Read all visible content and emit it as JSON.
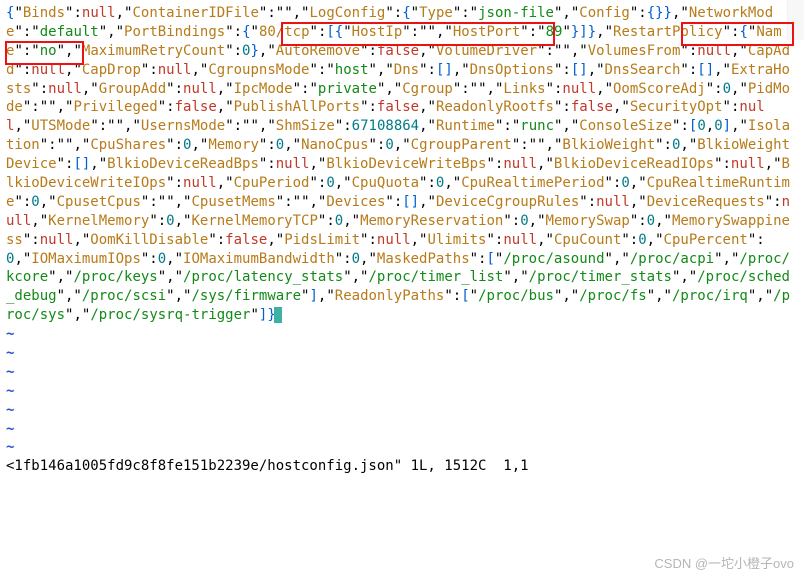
{
  "status_line": "<1fb146a1005fd9c8f8fe151b2239e/hostconfig.json\" 1L, 1512C  1,1",
  "watermark": "CSDN @一坨小橙子ovo",
  "t": {
    "Binds": "Binds",
    "ContainerIDFile": "ContainerIDFile",
    "LogConfig": "LogConfig",
    "Type": "Type",
    "json_file": "json-file",
    "Config": "Config",
    "NetworkMode": "NetworkMode",
    "default": "default",
    "PortBindings": "PortBindings",
    "port80": "80/tcp",
    "HostIp": "HostIp",
    "HostPort": "HostPort",
    "port89": "89",
    "RestartPolicy": "RestartPolicy",
    "Name": "Name",
    "no": "no",
    "MaximumRetryCount": "MaximumRetryCount",
    "AutoRemove": "AutoRemove",
    "VolumeDriver": "VolumeDriver",
    "VolumesFrom": "VolumesFrom",
    "CapAdd": "CapAdd",
    "CapDrop": "CapDrop",
    "CgroupnsMode": "CgroupnsMode",
    "host": "host",
    "Dns": "Dns",
    "DnsOptions": "DnsOptions",
    "DnsSearch": "DnsSearch",
    "ExtraHosts": "ExtraHosts",
    "GroupAdd": "GroupAdd",
    "IpcMode": "IpcMode",
    "private": "private",
    "Cgroup": "Cgroup",
    "Links": "Links",
    "OomScoreAdj": "OomScoreAdj",
    "PidMode": "PidMode",
    "Privileged": "Privileged",
    "PublishAllPorts": "PublishAllPorts",
    "ReadonlyRootfs": "ReadonlyRootfs",
    "SecurityOpt": "SecurityOpt",
    "UTSMode": "UTSMode",
    "UsernsMode": "UsernsMode",
    "ShmSize": "ShmSize",
    "shm": "67108864",
    "Runtime": "Runtime",
    "runc": "runc",
    "ConsoleSize": "ConsoleSize",
    "Isolation": "Isolation",
    "CpuShares": "CpuShares",
    "Memory": "Memory",
    "NanoCpus": "NanoCpus",
    "CgroupParent": "CgroupParent",
    "BlkioWeight": "BlkioWeight",
    "BlkioWeightDevice": "BlkioWeightDevice",
    "BlkioDeviceReadBps": "BlkioDeviceReadBps",
    "BlkioDeviceWriteBps": "BlkioDeviceWriteBps",
    "BlkioDeviceReadIOps": "BlkioDeviceReadIOps",
    "BlkioDeviceWriteIOps": "BlkioDeviceWriteIOps",
    "CpuPeriod": "CpuPeriod",
    "CpuQuota": "CpuQuota",
    "CpuRealtimePeriod": "CpuRealtimePeriod",
    "CpuRealtimeRuntime": "CpuRealtimeRuntime",
    "CpusetCpus": "CpusetCpus",
    "CpusetMems": "CpusetMems",
    "Devices": "Devices",
    "DeviceCgroupRules": "DeviceCgroupRules",
    "DeviceRequests": "DeviceRequests",
    "KernelMemory": "KernelMemory",
    "KernelMemoryTCP": "KernelMemoryTCP",
    "MemoryReservation": "MemoryReservation",
    "MemorySwap": "MemorySwap",
    "MemorySwappiness": "MemorySwappiness",
    "OomKillDisable": "OomKillDisable",
    "PidsLimit": "PidsLimit",
    "Ulimits": "Ulimits",
    "CpuCount": "CpuCount",
    "CpuPercent": "CpuPercent",
    "IOMaximumIOps": "IOMaximumIOps",
    "IOMaximumBandwidth": "IOMaximumBandwidth",
    "MaskedPaths": "MaskedPaths",
    "mp0": "/proc/asound",
    "mp1": "/proc/acpi",
    "mp2": "/proc/kcore",
    "mp3": "/proc/keys",
    "mp4": "/proc/latency_stats",
    "mp5": "/proc/timer_list",
    "mp6": "/proc/timer_stats",
    "mp7": "/proc/sched_debug",
    "mp8": "/proc/scsi",
    "mp9": "/sys/firmware",
    "ReadonlyPaths": "ReadonlyPaths",
    "rp0": "/proc/bus",
    "rp1": "/proc/fs",
    "rp2": "/proc/irq",
    "rp3": "/proc/sys",
    "rp4": "/proc/sysrq-trigger"
  },
  "v": {
    "null": "null",
    "false": "false",
    "zero": "0",
    "empty": ""
  }
}
